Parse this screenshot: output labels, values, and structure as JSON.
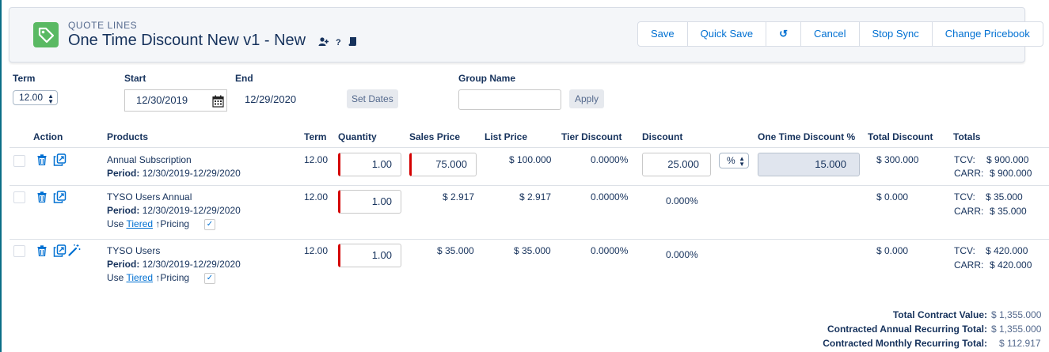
{
  "header": {
    "eyebrow": "QUOTE LINES",
    "title": "One Time Discount New v1 - New",
    "icons": [
      "add-user-icon",
      "help-icon",
      "book-icon"
    ],
    "buttons": [
      "Save",
      "Quick Save",
      "undo-icon",
      "Cancel",
      "Stop Sync",
      "Change Pricebook"
    ],
    "undo_glyph": "↺"
  },
  "filters": {
    "term_label": "Term",
    "term_value": "12.00",
    "start_label": "Start",
    "start_value": "12/30/2019",
    "end_label": "End",
    "end_value": "12/29/2020",
    "set_dates": "Set Dates",
    "group_label": "Group Name",
    "group_value": "",
    "apply": "Apply"
  },
  "columns": [
    "Action",
    "Products",
    "Term",
    "Quantity",
    "Sales Price",
    "List Price",
    "Tier Discount",
    "Discount",
    "One Time Discount %",
    "Total Discount",
    "Totals"
  ],
  "rows": [
    {
      "product": "Annual Subscription",
      "period_label": "Period:",
      "period": "12/30/2019-12/29/2020",
      "term": "12.00",
      "quantity": "1.00",
      "sales_price": "75.000",
      "list_price": "$ 100.000",
      "tier_discount": "0.0000%",
      "discount": "25.000",
      "discount_unit": "%",
      "one_time_discount": "15.000",
      "total_discount": "$ 300.000",
      "tcv_label": "TCV:",
      "tcv": "$ 900.000",
      "carr_label": "CARR:",
      "carr": "$ 900.000"
    },
    {
      "product": "TYSO Users Annual",
      "period_label": "Period:",
      "period": "12/30/2019-12/29/2020",
      "use": "Use",
      "tiered": "Tiered",
      "pricing": "Pricing",
      "term": "12.00",
      "quantity": "1.00",
      "sales_price": "$ 2.917",
      "list_price": "$ 2.917",
      "tier_discount": "0.0000%",
      "discount": "0.000%",
      "total_discount": "$ 0.000",
      "tcv_label": "TCV:",
      "tcv": "$ 35.000",
      "carr_label": "CARR:",
      "carr": "$ 35.000"
    },
    {
      "product": "TYSO Users",
      "period_label": "Period:",
      "period": "12/30/2019-12/29/2020",
      "use": "Use",
      "tiered": "Tiered",
      "pricing": "Pricing",
      "term": "12.00",
      "quantity": "1.00",
      "sales_price": "$ 35.000",
      "list_price": "$ 35.000",
      "tier_discount": "0.0000%",
      "discount": "0.000%",
      "total_discount": "$ 0.000",
      "tcv_label": "TCV:",
      "tcv": "$ 420.000",
      "carr_label": "CARR:",
      "carr": "$ 420.000"
    }
  ],
  "summary": [
    {
      "label": "Total Contract Value:",
      "value": "$ 1,355.000"
    },
    {
      "label": "Contracted Annual Recurring Total:",
      "value": "$ 1,355.000"
    },
    {
      "label": "Contracted Monthly Recurring Total:",
      "value": "$ 112.917"
    }
  ],
  "colors": {
    "accent": "#0070d2",
    "required": "#d40000",
    "icon_bg": "#5ab963",
    "text": "#16325c"
  }
}
